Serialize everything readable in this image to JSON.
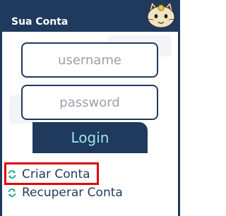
{
  "header": {
    "title": "Sua Conta",
    "mascot_icon": "cat-mascot-icon",
    "background_color": "#1f3a5c"
  },
  "login_form": {
    "username_placeholder": "username",
    "password_placeholder": "password",
    "login_label": "Login"
  },
  "links": {
    "create_account": "Criar Conta",
    "recover_account": "Recuperar Conta",
    "icon": "refresh-icon",
    "icon_color": "#2fae8a"
  },
  "highlight_color": "#e00000"
}
